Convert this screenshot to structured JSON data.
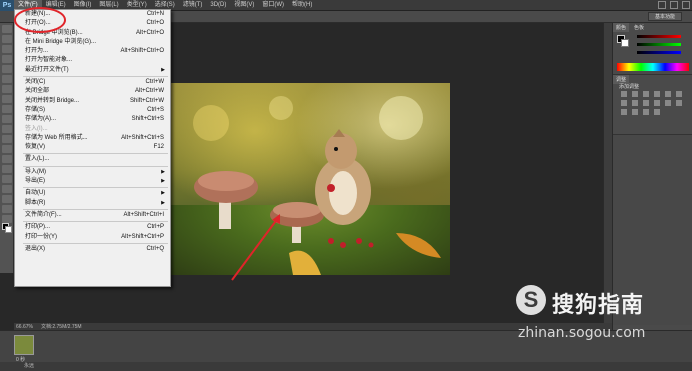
{
  "app": {
    "logo": "Ps"
  },
  "menubar": {
    "items": [
      "文件(F)",
      "编辑(E)",
      "图像(I)",
      "图层(L)",
      "类型(Y)",
      "选择(S)",
      "滤镜(T)",
      "3D(D)",
      "视图(V)",
      "窗口(W)",
      "帮助(H)"
    ]
  },
  "options": {
    "workspace": "基本功能"
  },
  "file_menu": {
    "groups": [
      [
        {
          "label": "新建(N)...",
          "shortcut": "Ctrl+N"
        },
        {
          "label": "打开(O)...",
          "shortcut": "Ctrl+O"
        },
        {
          "label": "在 Bridge 中浏览(B)...",
          "shortcut": "Alt+Ctrl+O"
        },
        {
          "label": "在 Mini Bridge 中浏览(G)...",
          "shortcut": ""
        },
        {
          "label": "打开为...",
          "shortcut": "Alt+Shift+Ctrl+O"
        },
        {
          "label": "打开为智能对象...",
          "shortcut": ""
        },
        {
          "label": "最近打开文件(T)",
          "shortcut": "",
          "submenu": true
        }
      ],
      [
        {
          "label": "关闭(C)",
          "shortcut": "Ctrl+W"
        },
        {
          "label": "关闭全部",
          "shortcut": "Alt+Ctrl+W"
        },
        {
          "label": "关闭并转到 Bridge...",
          "shortcut": "Shift+Ctrl+W"
        },
        {
          "label": "存储(S)",
          "shortcut": "Ctrl+S"
        },
        {
          "label": "存储为(A)...",
          "shortcut": "Shift+Ctrl+S"
        },
        {
          "label": "签入(I)...",
          "shortcut": "",
          "disabled": true
        },
        {
          "label": "存储为 Web 所用格式...",
          "shortcut": "Alt+Shift+Ctrl+S"
        },
        {
          "label": "恢复(V)",
          "shortcut": "F12"
        }
      ],
      [
        {
          "label": "置入(L)...",
          "shortcut": ""
        }
      ],
      [
        {
          "label": "导入(M)",
          "shortcut": "",
          "submenu": true
        },
        {
          "label": "导出(E)",
          "shortcut": "",
          "submenu": true
        }
      ],
      [
        {
          "label": "自动(U)",
          "shortcut": "",
          "submenu": true
        },
        {
          "label": "脚本(R)",
          "shortcut": "",
          "submenu": true
        }
      ],
      [
        {
          "label": "文件简介(F)...",
          "shortcut": "Alt+Shift+Ctrl+I"
        }
      ],
      [
        {
          "label": "打印(P)...",
          "shortcut": "Ctrl+P"
        },
        {
          "label": "打印一份(Y)",
          "shortcut": "Alt+Shift+Ctrl+P"
        }
      ],
      [
        {
          "label": "退出(X)",
          "shortcut": "Ctrl+Q"
        }
      ]
    ]
  },
  "status": {
    "zoom": "66.67%",
    "doc_size": "文档:2.75M/2.75M"
  },
  "timeline": {
    "frame_delay": "0 秒",
    "loop": "永远"
  },
  "panels": {
    "color_tab": "颜色",
    "swatches_tab": "色板",
    "adjust_tab": "调整",
    "adjust_hint": "添加调整"
  },
  "watermark": {
    "logo_glyph": "S",
    "title": "搜狗指南",
    "url": "zhinan.sogou.com"
  },
  "colors": {
    "annotation_red": "#e0242a",
    "menu_bg": "#f0f0f0"
  }
}
